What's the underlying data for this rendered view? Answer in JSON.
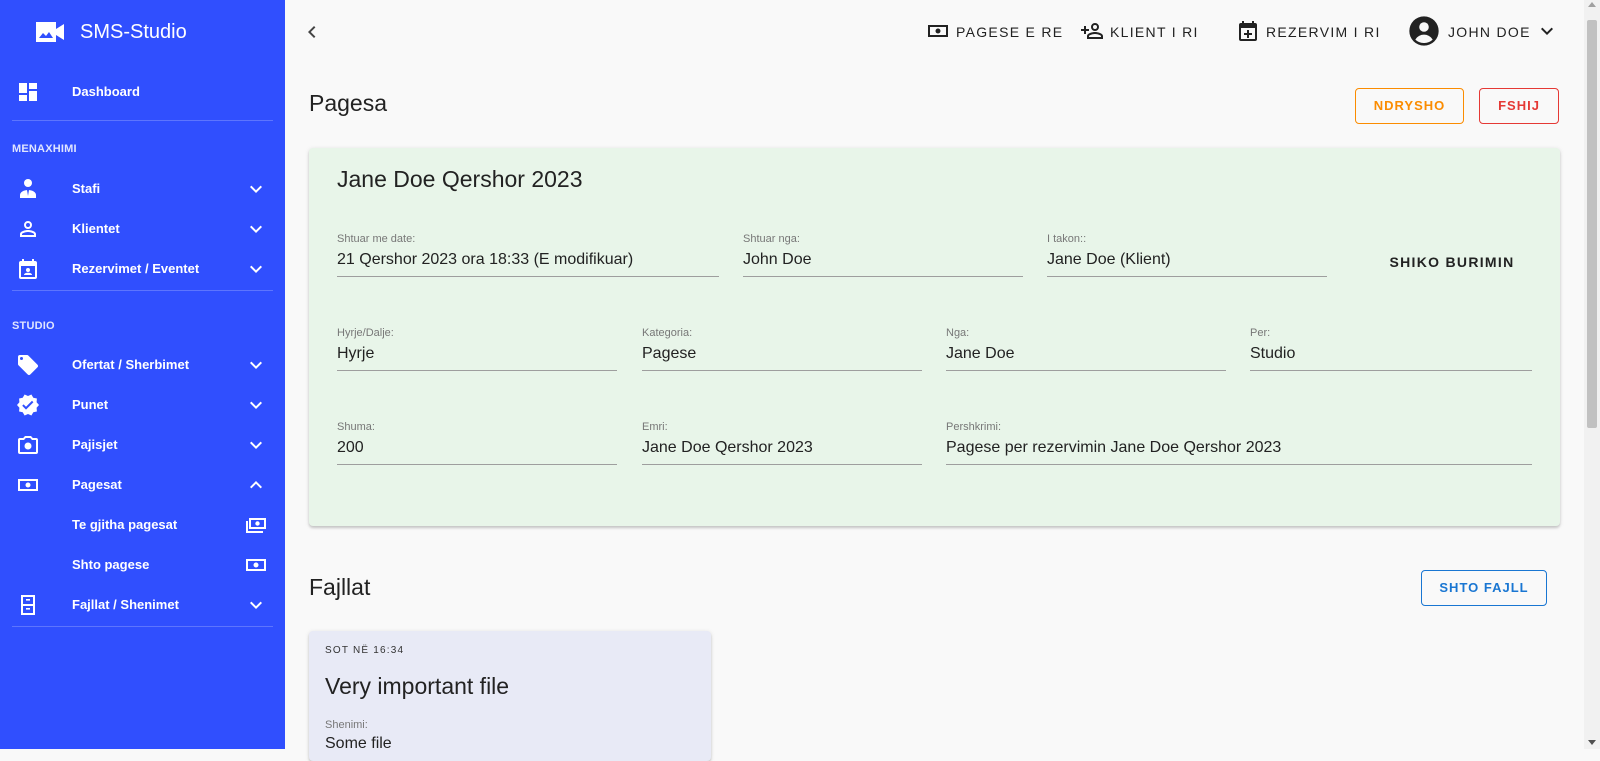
{
  "app": {
    "title": "SMS-Studio",
    "brand_icon": "video-camera-icon"
  },
  "sidebar": {
    "dashboard": {
      "label": "Dashboard",
      "icon": "dashboard-icon"
    },
    "sections": [
      {
        "label": "MENAXHIMI"
      },
      {
        "label": "STUDIO"
      }
    ],
    "items": [
      {
        "label": "Stafi",
        "icon": "staff-icon",
        "expanded": false
      },
      {
        "label": "Klientet",
        "icon": "person-icon",
        "expanded": false
      },
      {
        "label": "Rezervimet / Eventet",
        "icon": "calendar-icon",
        "expanded": false
      },
      {
        "label": "Ofertat / Sherbimet",
        "icon": "tag-icon",
        "expanded": false
      },
      {
        "label": "Punet",
        "icon": "verified-icon",
        "expanded": false
      },
      {
        "label": "Pajisjet",
        "icon": "camera-icon",
        "expanded": false
      },
      {
        "label": "Pagesat",
        "icon": "money-icon",
        "expanded": true
      },
      {
        "label": "Fajllat / Shenimet",
        "icon": "file-cabinet-icon",
        "expanded": false
      }
    ],
    "subitems": [
      {
        "label": "Te gjitha pagesat",
        "icon": "money-stack-icon"
      },
      {
        "label": "Shto pagese",
        "icon": "money-icon"
      }
    ]
  },
  "topbar": {
    "new_payment": "PAGESE E RE",
    "new_client": "KLIENT I RI",
    "new_booking": "REZERVIM I RI",
    "user": "JOHN DOE"
  },
  "page": {
    "title": "Pagesa",
    "edit_button": "NDRYSHO",
    "delete_button": "FSHIJ",
    "colors": {
      "accent": "#304ffe",
      "edit": "#fb8c00",
      "delete": "#e53935",
      "add_file": "#1976d2",
      "card_bg": "#e8f5e9"
    }
  },
  "payment": {
    "title": "Jane Doe Qershor 2023",
    "view_source": "SHIKO BURIMIN",
    "fields": {
      "added_on": {
        "label": "Shtuar me date:",
        "value": "21 Qershor 2023 ora 18:33 (E modifikuar)"
      },
      "added_by": {
        "label": "Shtuar nga:",
        "value": "John Doe"
      },
      "belongs_to": {
        "label": "I takon::",
        "value": "Jane Doe (Klient)"
      },
      "direction": {
        "label": "Hyrje/Dalje:",
        "value": "Hyrje"
      },
      "category": {
        "label": "Kategoria:",
        "value": "Pagese"
      },
      "from": {
        "label": "Nga:",
        "value": "Jane Doe"
      },
      "to": {
        "label": "Per:",
        "value": "Studio"
      },
      "amount": {
        "label": "Shuma:",
        "value": "200"
      },
      "name": {
        "label": "Emri:",
        "value": "Jane Doe Qershor 2023"
      },
      "description": {
        "label": "Pershkrimi:",
        "value": "Pagese per rezervimin Jane Doe Qershor 2023"
      }
    }
  },
  "files": {
    "title": "Fajllat",
    "add_button": "SHTO FAJLL",
    "items": [
      {
        "timestamp": "SOT NË 16:34",
        "title": "Very important file",
        "note_label": "Shenimi:",
        "note": "Some file"
      }
    ]
  }
}
